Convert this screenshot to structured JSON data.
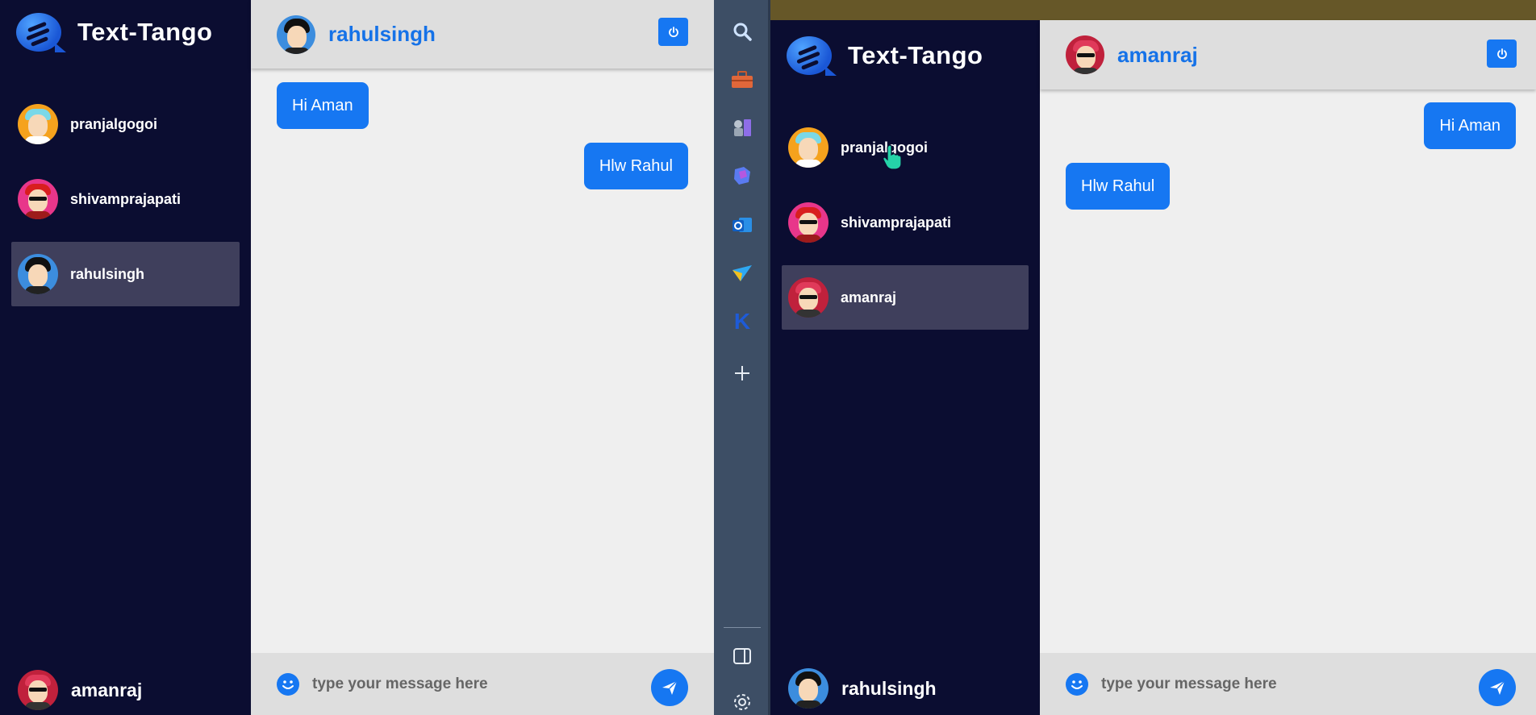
{
  "app_name": "Text-Tango",
  "left_window": {
    "contacts": [
      {
        "name": "pranjalgogoi",
        "active": false
      },
      {
        "name": "shivamprajapati",
        "active": false
      },
      {
        "name": "rahulsingh",
        "active": true
      }
    ],
    "current_user": "amanraj",
    "chat": {
      "contact_name": "rahulsingh",
      "messages": [
        {
          "text": "Hi Aman",
          "side": "left"
        },
        {
          "text": "Hlw Rahul",
          "side": "right"
        }
      ],
      "input_placeholder": "type your message here"
    }
  },
  "right_window": {
    "contacts": [
      {
        "name": "pranjalgogoi",
        "active": false
      },
      {
        "name": "shivamprajapati",
        "active": false
      },
      {
        "name": "amanraj",
        "active": true
      }
    ],
    "current_user": "rahulsingh",
    "chat": {
      "contact_name": "amanraj",
      "messages": [
        {
          "text": "Hi Aman",
          "side": "right"
        },
        {
          "text": "Hlw Rahul",
          "side": "left"
        }
      ],
      "input_placeholder": "type your message here"
    }
  },
  "toolbar": {
    "icons": [
      "search-icon",
      "toolbox-icon",
      "chess-icon",
      "copilot-icon",
      "outlook-icon",
      "send-plane-icon",
      "k-icon",
      "plus-icon",
      "sidebar-panel-icon",
      "gear-icon"
    ],
    "k_label": "K"
  },
  "colors": {
    "sidebar_bg": "#0b0d31",
    "accent": "#1677f2",
    "active_contact_bg": "#3f3f5c",
    "chat_bg": "#efefef",
    "header_bg": "#dedede",
    "toolbar_bg": "#3d4e65",
    "top_strip": "#665728"
  }
}
